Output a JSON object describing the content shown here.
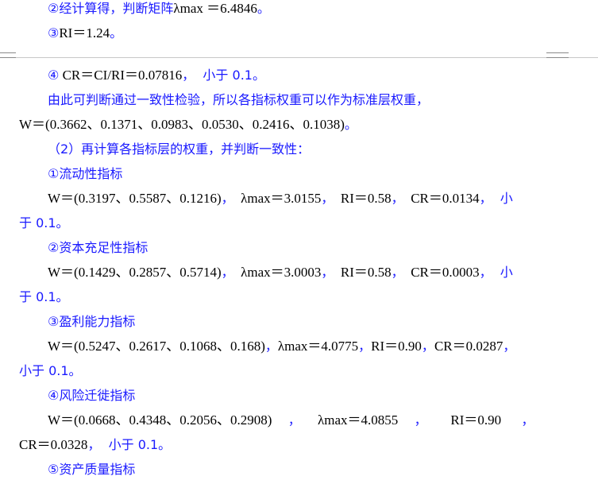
{
  "lines": [
    {
      "parts": [
        {
          "t": "②经计算得，判断矩阵",
          "c": "blue"
        },
        {
          "t": "λmax ＝6.4846",
          "c": "black"
        },
        {
          "t": "。",
          "c": "blue"
        }
      ]
    },
    {
      "parts": [
        {
          "t": "③",
          "c": "blue"
        },
        {
          "t": "RI＝1.24",
          "c": "black"
        },
        {
          "t": "。",
          "c": "blue"
        }
      ]
    },
    {
      "parts": [
        {
          "t": "④",
          "c": "blue"
        },
        {
          "t": " CR＝CI/RI＝0.07816",
          "c": "black"
        },
        {
          "t": "，  小于 0.1。",
          "c": "blue"
        }
      ]
    },
    {
      "parts": [
        {
          "t": "由此可判断通过一致性检验，所以各指标权重可以作为标准层权重，",
          "c": "blue"
        }
      ]
    },
    {
      "parts": [
        {
          "t": "W＝(0.3662、0.1371、0.0983、0.0530、0.2416、0.1038)",
          "c": "black"
        },
        {
          "t": "。",
          "c": "blue"
        }
      ]
    },
    {
      "parts": [
        {
          "t": "（2）再计算各指标层的权重，并判断一致性：",
          "c": "blue"
        }
      ]
    },
    {
      "parts": [
        {
          "t": "①流动性指标",
          "c": "blue"
        }
      ]
    },
    {
      "parts": [
        {
          "t": "W＝(0.3197、0.5587、0.1216)",
          "c": "black"
        },
        {
          "t": "，",
          "c": "blue"
        },
        {
          "t": "  λmax＝3.0155",
          "c": "black"
        },
        {
          "t": "，",
          "c": "blue"
        },
        {
          "t": "  RI＝0.58",
          "c": "black"
        },
        {
          "t": "，",
          "c": "blue"
        },
        {
          "t": "  CR＝0.0134",
          "c": "black"
        },
        {
          "t": "，  小",
          "c": "blue"
        }
      ]
    },
    {
      "parts": [
        {
          "t": "于 0.1。",
          "c": "blue"
        }
      ]
    },
    {
      "parts": [
        {
          "t": "②资本充足性指标",
          "c": "blue"
        }
      ]
    },
    {
      "parts": [
        {
          "t": "W＝(0.1429、0.2857、0.5714)",
          "c": "black"
        },
        {
          "t": "，",
          "c": "blue"
        },
        {
          "t": "  λmax＝3.0003",
          "c": "black"
        },
        {
          "t": "，",
          "c": "blue"
        },
        {
          "t": "  RI＝0.58",
          "c": "black"
        },
        {
          "t": "，",
          "c": "blue"
        },
        {
          "t": "  CR＝0.0003",
          "c": "black"
        },
        {
          "t": "，  小",
          "c": "blue"
        }
      ]
    },
    {
      "parts": [
        {
          "t": "于 0.1。",
          "c": "blue"
        }
      ]
    },
    {
      "parts": [
        {
          "t": "③盈利能力指标",
          "c": "blue"
        }
      ]
    },
    {
      "parts": [
        {
          "t": "W＝(0.5247、0.2617、0.1068、0.168)",
          "c": "black"
        },
        {
          "t": "，",
          "c": "blue"
        },
        {
          "t": "λmax＝4.0775",
          "c": "black"
        },
        {
          "t": "，",
          "c": "blue"
        },
        {
          "t": "RI＝0.90",
          "c": "black"
        },
        {
          "t": "，",
          "c": "blue"
        },
        {
          "t": "CR＝0.0287",
          "c": "black"
        },
        {
          "t": "，",
          "c": "blue"
        }
      ]
    },
    {
      "parts": [
        {
          "t": "小于 0.1。",
          "c": "blue"
        }
      ]
    },
    {
      "parts": [
        {
          "t": "④风险迁徙指标",
          "c": "blue"
        }
      ]
    },
    {
      "parts": [
        {
          "t": "W＝(0.0668、0.4348、0.2056、0.2908)",
          "c": "black"
        },
        {
          "t": "    ，",
          "c": "blue"
        },
        {
          "t": "     λmax＝4.0855",
          "c": "black"
        },
        {
          "t": "    ，",
          "c": "blue"
        },
        {
          "t": "       RI＝0.90",
          "c": "black"
        },
        {
          "t": "     ，",
          "c": "blue"
        }
      ]
    },
    {
      "parts": [
        {
          "t": "CR＝0.0328",
          "c": "black"
        },
        {
          "t": "，  小于 0.1。",
          "c": "blue"
        }
      ]
    },
    {
      "parts": [
        {
          "t": "⑤资产质量指标",
          "c": "blue"
        }
      ]
    }
  ]
}
